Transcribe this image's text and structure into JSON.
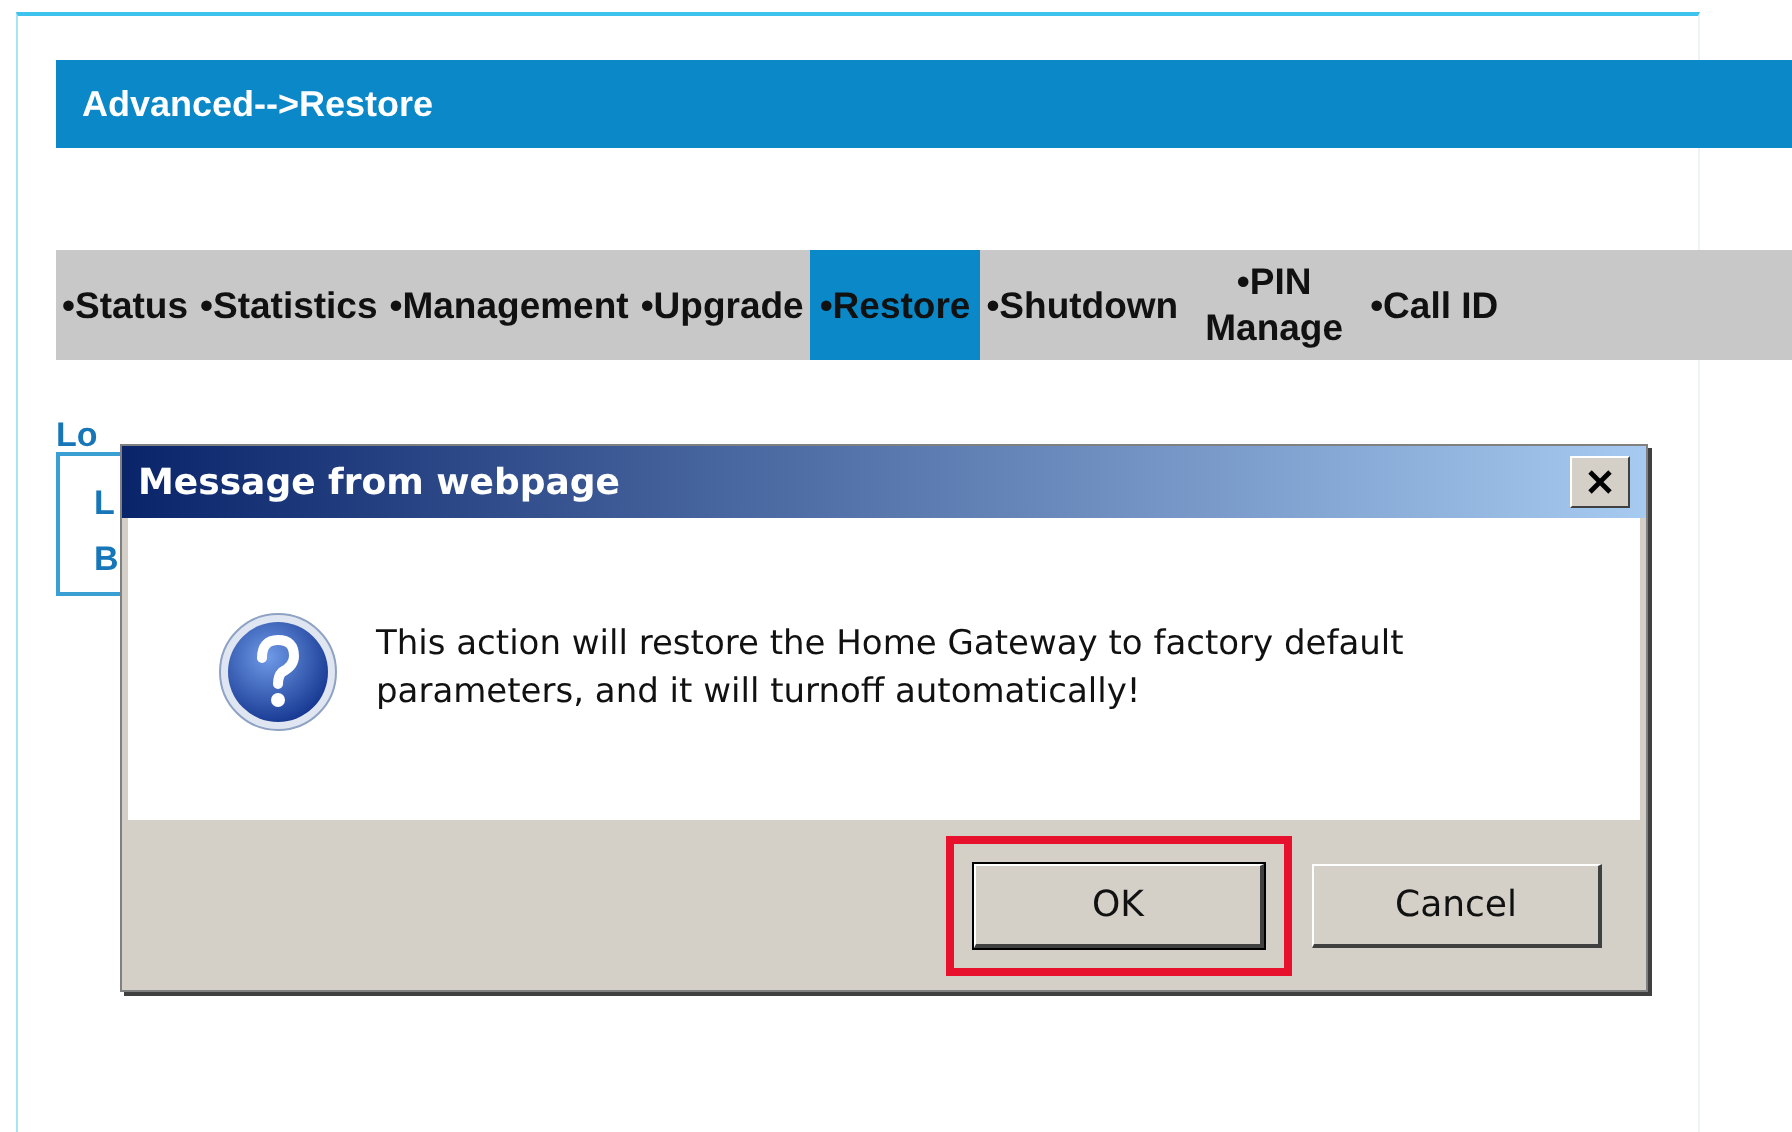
{
  "header": {
    "title": "Advanced-->Restore"
  },
  "nav": [
    {
      "label": "•Status",
      "selected": false
    },
    {
      "label": "•Statistics",
      "selected": false
    },
    {
      "label": "•Management",
      "selected": false
    },
    {
      "label": "•Upgrade",
      "selected": false
    },
    {
      "label": "•Restore",
      "selected": true
    },
    {
      "label": "•Shutdown",
      "selected": false
    },
    {
      "label": "•PIN Manage",
      "selected": false
    },
    {
      "label": "•Call ID",
      "selected": false
    }
  ],
  "section": {
    "link": "Lo",
    "panel_lines": [
      "L",
      "B"
    ]
  },
  "dialog": {
    "title": "Message from webpage",
    "message": "This action will restore the Home Gateway to factory default parameters, and it will turnoff automatically!",
    "buttons": [
      {
        "label": "OK",
        "highlighted": true
      },
      {
        "label": "Cancel",
        "highlighted": false
      }
    ]
  }
}
